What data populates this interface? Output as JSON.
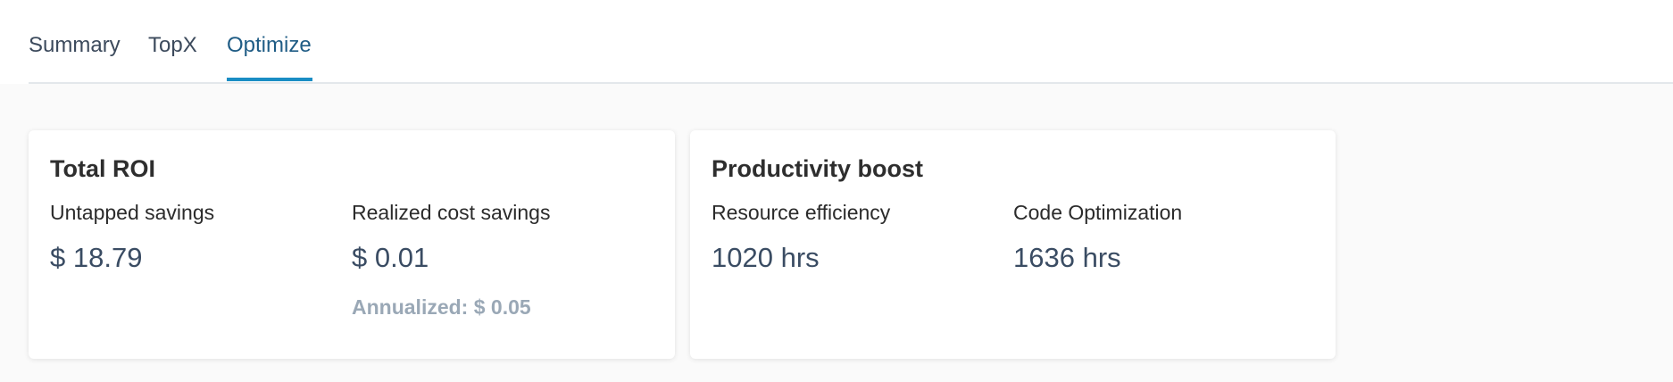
{
  "tabs": [
    {
      "label": "Summary"
    },
    {
      "label": "TopX"
    },
    {
      "label": "Optimize"
    }
  ],
  "active_tab": "Optimize",
  "cards": {
    "total_roi": {
      "title": "Total ROI",
      "untapped": {
        "label": "Untapped savings",
        "value": "$ 18.79"
      },
      "realized": {
        "label": "Realized cost savings",
        "value": "$ 0.01",
        "annualized": "Annualized: $ 0.05"
      }
    },
    "productivity": {
      "title": "Productivity boost",
      "resource": {
        "label": "Resource efficiency",
        "value": "1020 hrs"
      },
      "code": {
        "label": "Code Optimization",
        "value": "1636 hrs"
      }
    }
  },
  "colors": {
    "accent": "#1a8dc4",
    "value_text": "#3a4c63",
    "muted_text": "#9aa8b6"
  }
}
